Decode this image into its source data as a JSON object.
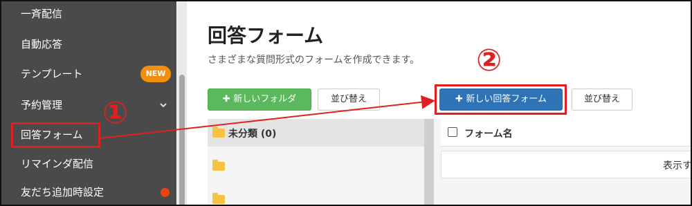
{
  "sidebar": {
    "items": [
      {
        "label": "一斉配信"
      },
      {
        "label": "自動応答"
      },
      {
        "label": "テンプレート",
        "badge": "NEW"
      },
      {
        "label": "予約管理"
      },
      {
        "label": "回答フォーム"
      },
      {
        "label": "リマインダ配信"
      },
      {
        "label": "友だち追加時設定"
      }
    ]
  },
  "annotations": {
    "step1": "①",
    "step2": "②"
  },
  "main": {
    "title": "回答フォーム",
    "subtitle": "さまざまな質問形式のフォームを作成できます。",
    "buttons": {
      "new_folder": "新しいフォルダ",
      "sort1": "並び替え",
      "new_form": "新しい回答フォーム",
      "sort2": "並び替え"
    },
    "folder_panel": {
      "uncategorized": "未分類 (0)"
    },
    "form_panel": {
      "column_title": "フォーム名",
      "display_text": "表示す"
    }
  },
  "colors": {
    "sidebar_bg": "#4a4a4a",
    "badge": "#f0900c",
    "green_button": "#5cb85c",
    "blue_button": "#2d73b5",
    "annotation_red": "#e02020"
  }
}
